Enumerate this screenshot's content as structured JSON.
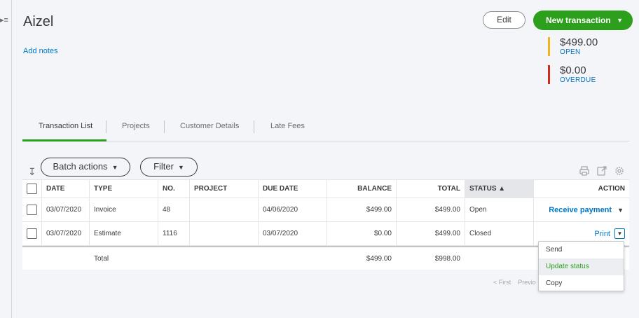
{
  "customer": {
    "name": "Aizel",
    "add_notes": "Add notes"
  },
  "header": {
    "edit_label": "Edit",
    "new_transaction_label": "New transaction"
  },
  "summary": {
    "open_amount": "$499.00",
    "open_label": "OPEN",
    "overdue_amount": "$0.00",
    "overdue_label": "OVERDUE"
  },
  "tabs": [
    {
      "label": "Transaction List",
      "active": true
    },
    {
      "label": "Projects"
    },
    {
      "label": "Customer Details"
    },
    {
      "label": "Late Fees"
    }
  ],
  "toolbar": {
    "batch_actions": "Batch actions",
    "filter": "Filter"
  },
  "table": {
    "headers": [
      "DATE",
      "TYPE",
      "NO.",
      "PROJECT",
      "DUE DATE",
      "BALANCE",
      "TOTAL",
      "STATUS ▲",
      "ACTION"
    ],
    "rows": [
      {
        "date": "03/07/2020",
        "type": "Invoice",
        "no": "48",
        "project": "",
        "due_date": "04/06/2020",
        "balance": "$499.00",
        "total": "$499.00",
        "status": "Open",
        "action": "Receive payment"
      },
      {
        "date": "03/07/2020",
        "type": "Estimate",
        "no": "1116",
        "project": "",
        "due_date": "03/07/2020",
        "balance": "$0.00",
        "total": "$499.00",
        "status": "Closed",
        "action": "Print"
      }
    ],
    "total_row": {
      "label": "Total",
      "balance": "$499.00",
      "total": "$998.00"
    }
  },
  "pagination": {
    "first": "< First",
    "previous": "Previo"
  },
  "dropdown": {
    "items": [
      "Send",
      "Update status",
      "Copy"
    ],
    "highlighted_index": 1
  },
  "colors": {
    "accent_green": "#2ca01c",
    "link_blue": "#0077c5",
    "open_bar": "#f2b41b",
    "overdue_bar": "#d52b1e"
  }
}
